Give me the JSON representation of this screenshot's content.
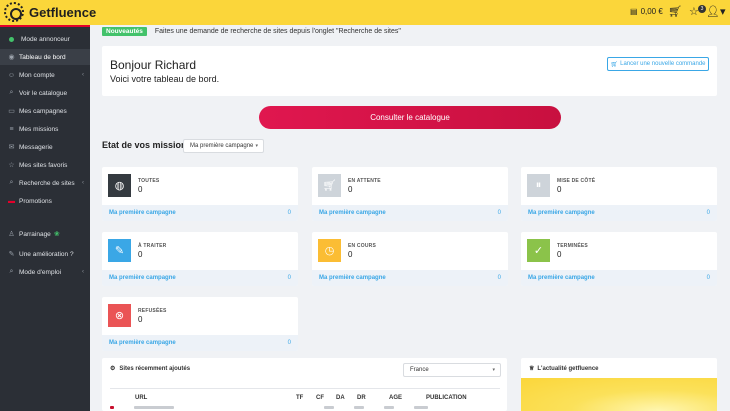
{
  "topbar": {
    "brand": "Getfluence",
    "wallet": "0,00 €",
    "favorites_count": "3"
  },
  "sidebar": {
    "items": [
      {
        "label": "Mode annonceur",
        "icon": "status-dot-icon"
      },
      {
        "label": "Tableau de bord",
        "icon": "dashboard-icon"
      },
      {
        "label": "Mon compte",
        "icon": "user-icon",
        "chevron": "‹"
      },
      {
        "label": "Voir le catalogue",
        "icon": "search-icon"
      },
      {
        "label": "Mes campagnes",
        "icon": "folder-icon"
      },
      {
        "label": "Mes missions",
        "icon": "list-icon"
      },
      {
        "label": "Messagerie",
        "icon": "message-icon"
      },
      {
        "label": "Mes sites favoris",
        "icon": "star-icon"
      },
      {
        "label": "Recherche de sites",
        "icon": "search-icon",
        "chevron": "‹"
      },
      {
        "label": "Promotions",
        "icon": "promo-icon"
      },
      {
        "label": "Parrainage",
        "icon": "referral-icon"
      },
      {
        "label": "Une amélioration ?",
        "icon": "wrench-icon"
      },
      {
        "label": "Mode d'emploi",
        "icon": "help-icon",
        "chevron": "‹"
      }
    ]
  },
  "news": {
    "badge": "Nouveautés",
    "text": "Faites une demande de recherche de sites depuis l'onglet \"Recherche de sites\""
  },
  "welcome": {
    "greeting": "Bonjour Richard",
    "subtitle": "Voici votre tableau de bord.",
    "new_order_label": "Lancer une nouvelle commande"
  },
  "cta_label": "Consulter le catalogue",
  "missions": {
    "title": "Etat de vos missions",
    "campaign_select": "Ma première campagne",
    "cards": [
      {
        "label": "TOUTES",
        "count": "0",
        "campaign": "Ma première campagne",
        "campaign_count": "0",
        "color": "#343a40",
        "icon": "globe-icon"
      },
      {
        "label": "EN ATTENTE",
        "count": "0",
        "campaign": "Ma première campagne",
        "campaign_count": "0",
        "color": "#ced4da",
        "icon": "cart-icon"
      },
      {
        "label": "MISE DE CÔTÉ",
        "count": "0",
        "campaign": "Ma première campagne",
        "campaign_count": "0",
        "color": "#ced4da",
        "icon": "pause-icon"
      },
      {
        "label": "À TRAITER",
        "count": "0",
        "campaign": "Ma première campagne",
        "campaign_count": "0",
        "color": "#3aa7e6",
        "icon": "edit-icon"
      },
      {
        "label": "EN COURS",
        "count": "0",
        "campaign": "Ma première campagne",
        "campaign_count": "0",
        "color": "#fbbd34",
        "icon": "clock-icon"
      },
      {
        "label": "TERMINÉES",
        "count": "0",
        "campaign": "Ma première campagne",
        "campaign_count": "0",
        "color": "#8bc34a",
        "icon": "check-icon"
      },
      {
        "label": "REFUSÉES",
        "count": "0",
        "campaign": "Ma première campagne",
        "campaign_count": "0",
        "color": "#ea5455",
        "icon": "close-icon"
      }
    ]
  },
  "recent_sites": {
    "title": "Sites récemment ajoutés",
    "country": "France",
    "columns": [
      "URL",
      "TF",
      "CF",
      "DA",
      "DR",
      "AGE",
      "PUBLICATION"
    ]
  },
  "news_panel": {
    "title": "L'actualité getfluence"
  }
}
